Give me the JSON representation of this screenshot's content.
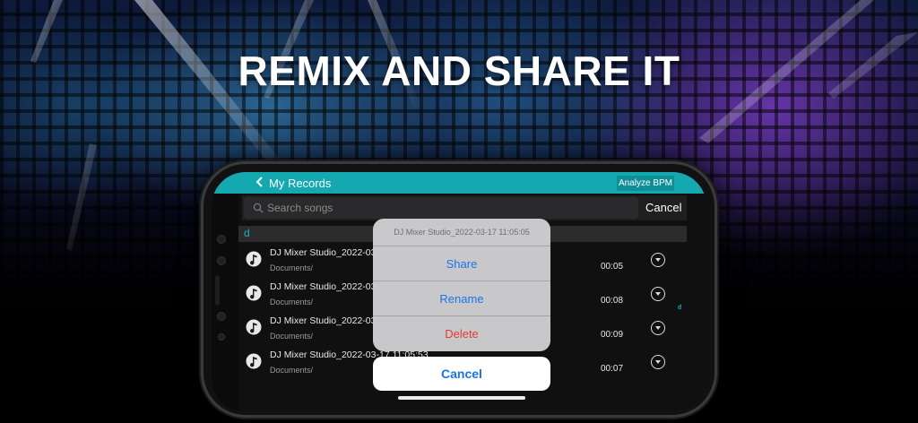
{
  "headline": "REMIX AND SHARE IT",
  "nav": {
    "title": "My Records",
    "analyze_label": "Analyze BPM"
  },
  "search": {
    "placeholder": "Search songs",
    "cancel_label": "Cancel"
  },
  "section": {
    "letter": "d"
  },
  "index_letter": "d",
  "rows": [
    {
      "title": "DJ Mixer Studio_2022-03",
      "subtitle": "Documents/",
      "duration": "00:05"
    },
    {
      "title": "DJ Mixer Studio_2022-03",
      "subtitle": "Documents/",
      "duration": "00:08"
    },
    {
      "title": "DJ Mixer Studio_2022-03",
      "subtitle": "Documents/",
      "duration": "00:09"
    },
    {
      "title": "DJ Mixer Studio_2022-03-17 11:05:53",
      "subtitle": "Documents/",
      "duration": "00:07"
    }
  ],
  "action_sheet": {
    "title": "DJ Mixer Studio_2022-03-17 11:05:05",
    "share_label": "Share",
    "rename_label": "Rename",
    "delete_label": "Delete",
    "cancel_label": "Cancel"
  },
  "colors": {
    "accent": "#14a9b0",
    "action_blue": "#1a73e8",
    "destructive_red": "#e53935"
  },
  "icons": {
    "back": "chevron-left-icon",
    "search": "search-icon",
    "song": "music-note-icon",
    "more": "chevron-down-circle-icon"
  }
}
